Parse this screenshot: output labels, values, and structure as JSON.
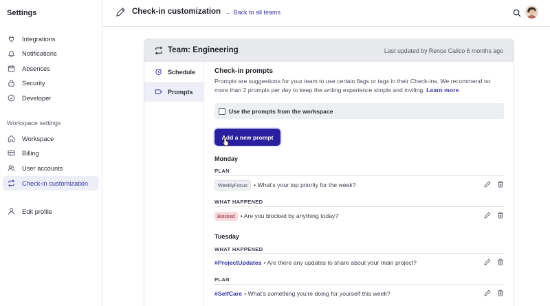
{
  "sidebar": {
    "title": "Settings",
    "items": [
      {
        "label": "Integrations",
        "icon": "plug-icon"
      },
      {
        "label": "Notifications",
        "icon": "bell-icon"
      },
      {
        "label": "Absences",
        "icon": "calendar-icon"
      },
      {
        "label": "Security",
        "icon": "lock-icon"
      },
      {
        "label": "Developer",
        "icon": "check-circle-icon"
      }
    ],
    "workspace_section_label": "Workspace settings",
    "workspace_items": [
      {
        "label": "Workspace",
        "icon": "home-icon"
      },
      {
        "label": "Billing",
        "icon": "credit-card-icon"
      },
      {
        "label": "User accounts",
        "icon": "users-icon"
      },
      {
        "label": "Check-in customization",
        "icon": "repeat-icon",
        "active": true
      }
    ],
    "edit_profile": {
      "label": "Edit profile",
      "icon": "user-icon"
    }
  },
  "header": {
    "title": "Check-in customization",
    "back_link": "← Back to all teams"
  },
  "team": {
    "title": "Team: Engineering",
    "updated": "Last updated by Rence Calico 6 months ago"
  },
  "subnav": [
    {
      "label": "Schedule",
      "icon": "alarm-clock-icon"
    },
    {
      "label": "Prompts",
      "icon": "tag-icon",
      "active": true
    }
  ],
  "prompts": {
    "heading": "Check-in prompts",
    "description": "Prompts are suggestions for your team to use certain flags or tags in their Check-ins. We recommend no more than 2 prompts per day to keep the writing experience simple and inviting.",
    "learn_more": "Learn more",
    "workspace_checkbox_label": "Use the prompts from the workspace",
    "workspace_checkbox_checked": false,
    "add_button": "Add a new prompt"
  },
  "days": [
    {
      "day": "Monday",
      "groups": [
        {
          "category": "PLAN",
          "prompt": {
            "tag": "WeeklyFocus",
            "tag_style": "gray",
            "text": "• What's your top priority for the week?"
          }
        },
        {
          "category": "WHAT HAPPENED",
          "prompt": {
            "tag": "Blocked",
            "tag_style": "red",
            "text": "• Are you blocked by anything today?"
          }
        }
      ]
    },
    {
      "day": "Tuesday",
      "groups": [
        {
          "category": "WHAT HAPPENED",
          "prompt": {
            "hashtag": "#ProjectUpdates",
            "text": "• Are there any updates to share about your main project?"
          }
        },
        {
          "category": "PLAN",
          "prompt": {
            "hashtag": "#SelfCare",
            "text": "• What's something you're doing for yourself this week?"
          }
        }
      ]
    }
  ],
  "colors": {
    "accent": "#3a35a6",
    "button": "#2a1f9e",
    "active_bg": "#edeef7",
    "card_header": "#e8e9ed",
    "blocked_tag_bg": "#f8d9dd"
  }
}
